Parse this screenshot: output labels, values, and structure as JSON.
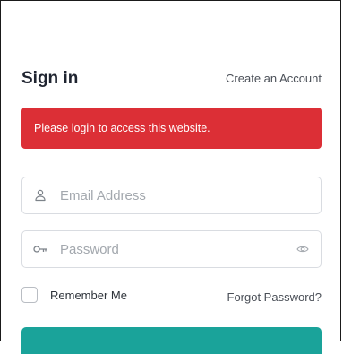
{
  "form": {
    "title": "Sign in",
    "create_account_label": "Create an Account",
    "alert_message": "Please login to access this website.",
    "email_placeholder": "Email Address",
    "password_placeholder": "Password",
    "remember_label": "Remember Me",
    "forgot_label": "Forgot Password?",
    "remember_checked": false
  },
  "icons": {
    "email": "user-icon",
    "password": "key-icon",
    "reveal": "eye-icon"
  },
  "colors": {
    "alert_bg": "#dc2f36",
    "primary": "#1aa39a",
    "border": "#d9dce1"
  }
}
